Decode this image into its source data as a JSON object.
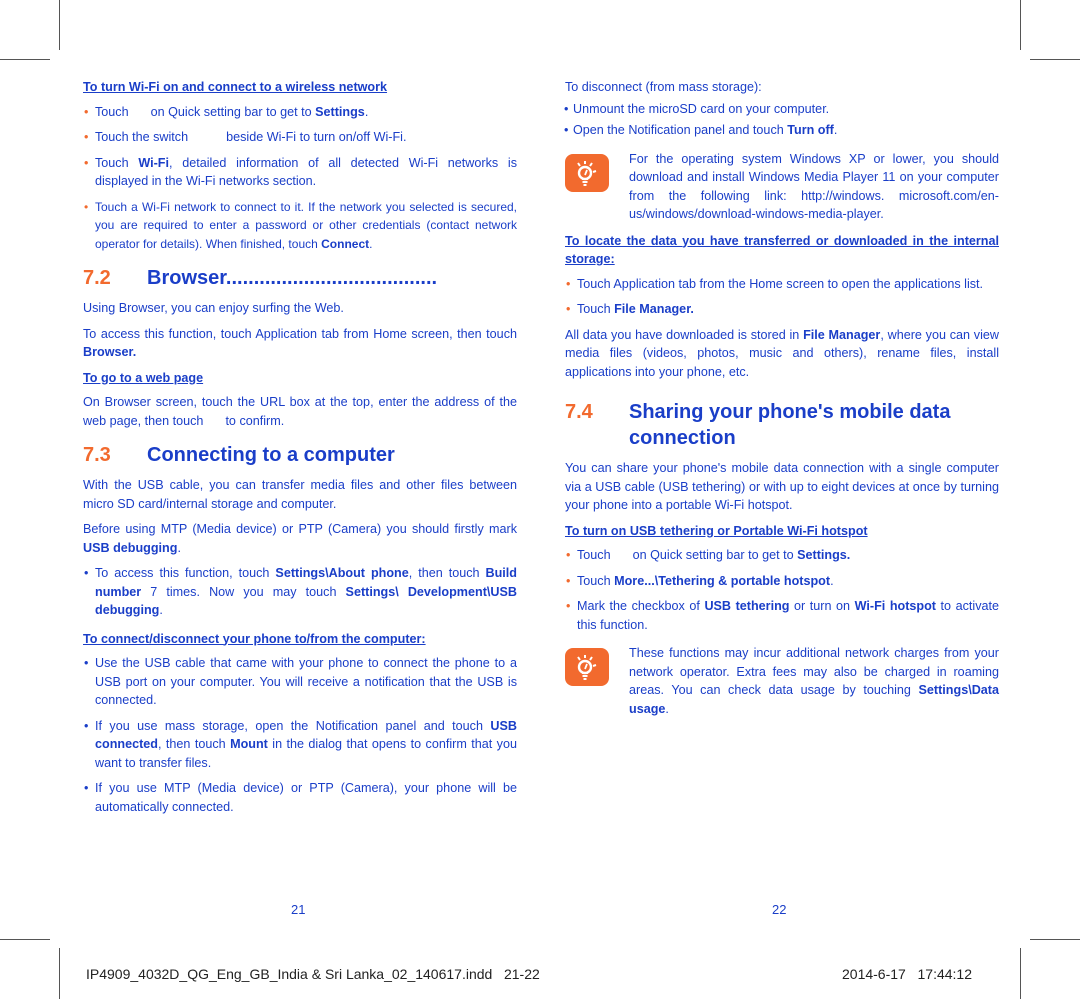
{
  "left_page": {
    "wifi": {
      "heading": "To turn Wi-Fi on and connect to a wireless network",
      "items": [
        {
          "pre": "Touch",
          "gap": true,
          "post": "on Quick setting bar to get to ",
          "bold": "Settings",
          "end": "."
        },
        {
          "pre": "Touch the switch",
          "gap": true,
          "post": "beside Wi-Fi to  turn on/off Wi-Fi.",
          "bold": "",
          "end": ""
        },
        {
          "pre": "Touch ",
          "bold1": "Wi-Fi",
          "post": ", detailed information of all detected Wi-Fi networks is displayed in the Wi-Fi networks section."
        },
        {
          "pre": "Touch a Wi-Fi network to connect to it. If the network you selected is secured, you are required to enter a password or other credentials (contact network operator for details). When finished, touch ",
          "bold": "Connect",
          "end": "."
        }
      ]
    },
    "browser": {
      "num": "7.2",
      "title": "Browser......................................",
      "p1": "Using Browser, you can enjoy surfing the Web.",
      "p2_pre": "To access this function, touch Application tab from Home screen, then touch ",
      "p2_bold": "Browser.",
      "subheading": "To go to a web page",
      "p3_pre": "On Browser screen, touch the URL box at the top, enter the address of the web page, then touch",
      "p3_post": "to confirm."
    },
    "computer": {
      "num": "7.3",
      "title": "Connecting to a computer",
      "p1": "With the USB cable, you can transfer media files and other files between micro SD card/internal storage and computer.",
      "p2_pre": "Before using MTP (Media device) or PTP (Camera) you should firstly mark ",
      "p2_bold": "USB debugging",
      "p2_end": ".",
      "item1_pre": "To access this function, touch ",
      "item1_b1": "Settings\\About phone",
      "item1_mid": ", then touch ",
      "item1_b2": "Build number",
      "item1_mid2": " 7 times. Now you may touch ",
      "item1_b3": "Settings\\ Development\\USB debugging",
      "item1_end": ".",
      "subheading": "To connect/disconnect your phone to/from the computer:",
      "c1": "Use the USB cable that came with your phone to connect the phone to a USB port on your computer. You will receive a notification that the USB is connected.",
      "c2_pre": "If you use mass storage, open the Notification panel and touch ",
      "c2_b1": "USB connected",
      "c2_mid": ", then touch ",
      "c2_b2": "Mount",
      "c2_end": " in the dialog that opens to confirm that you want to transfer files.",
      "c3": "If you use MTP (Media device) or PTP (Camera), your phone will be automatically connected."
    },
    "page_number": "21"
  },
  "right_page": {
    "disconnect": {
      "intro": "To disconnect (from mass storage):",
      "d1": "Unmount the microSD card on your computer.",
      "d2_pre": "Open the Notification panel and touch ",
      "d2_bold": "Turn off",
      "d2_end": "."
    },
    "note1": "For the operating system Windows XP or lower, you should download and install Windows Media Player 11 on your computer from the following link: http://windows. microsoft.com/en-us/windows/download-windows-media-player.",
    "locate": {
      "subheading": "To locate the data you have transferred or downloaded in the internal storage:",
      "l1": "Touch Application tab from the Home screen to open the applications list.",
      "l2_pre": "Touch ",
      "l2_bold": "File Manager.",
      "p_pre": "All data you have downloaded is stored in ",
      "p_bold": "File Manager",
      "p_end": ", where you can view media files (videos, photos, music and others), rename files, install applications into your phone, etc."
    },
    "sharing": {
      "num": "7.4",
      "title": "Sharing your phone's mobile data connection",
      "p1": "You can share your phone's mobile data connection with a single computer via a USB cable (USB tethering) or with up to eight devices at once by turning your phone into a portable Wi-Fi hotspot.",
      "subheading": "To turn on USB tethering or Portable Wi-Fi hotspot",
      "s1_pre": "Touch",
      "s1_post": "on Quick setting bar to get to ",
      "s1_bold": "Settings.",
      "s2_pre": "Touch ",
      "s2_bold": "More...\\Tethering & portable hotspot",
      "s2_end": ".",
      "s3_pre": "Mark the checkbox of ",
      "s3_b1": "USB tethering",
      "s3_mid": " or turn on ",
      "s3_b2": "Wi-Fi hotspot",
      "s3_end": " to activate this function."
    },
    "note2_pre": "These functions may incur additional network charges from your network operator. Extra fees may also be charged in roaming areas. You can check data usage by touching ",
    "note2_bold": "Settings\\Data usage",
    "note2_end": ".",
    "page_number": "22"
  },
  "footer": {
    "filename": "IP4909_4032D_QG_Eng_GB_India & Sri Lanka_02_140617.indd   21-22",
    "timestamp": "2014-6-17   17:44:12"
  },
  "icons": {
    "bullet": "•",
    "tip": "lightbulb-icon"
  },
  "colors": {
    "text": "#1a3ec8",
    "accent": "#f26a2e"
  }
}
